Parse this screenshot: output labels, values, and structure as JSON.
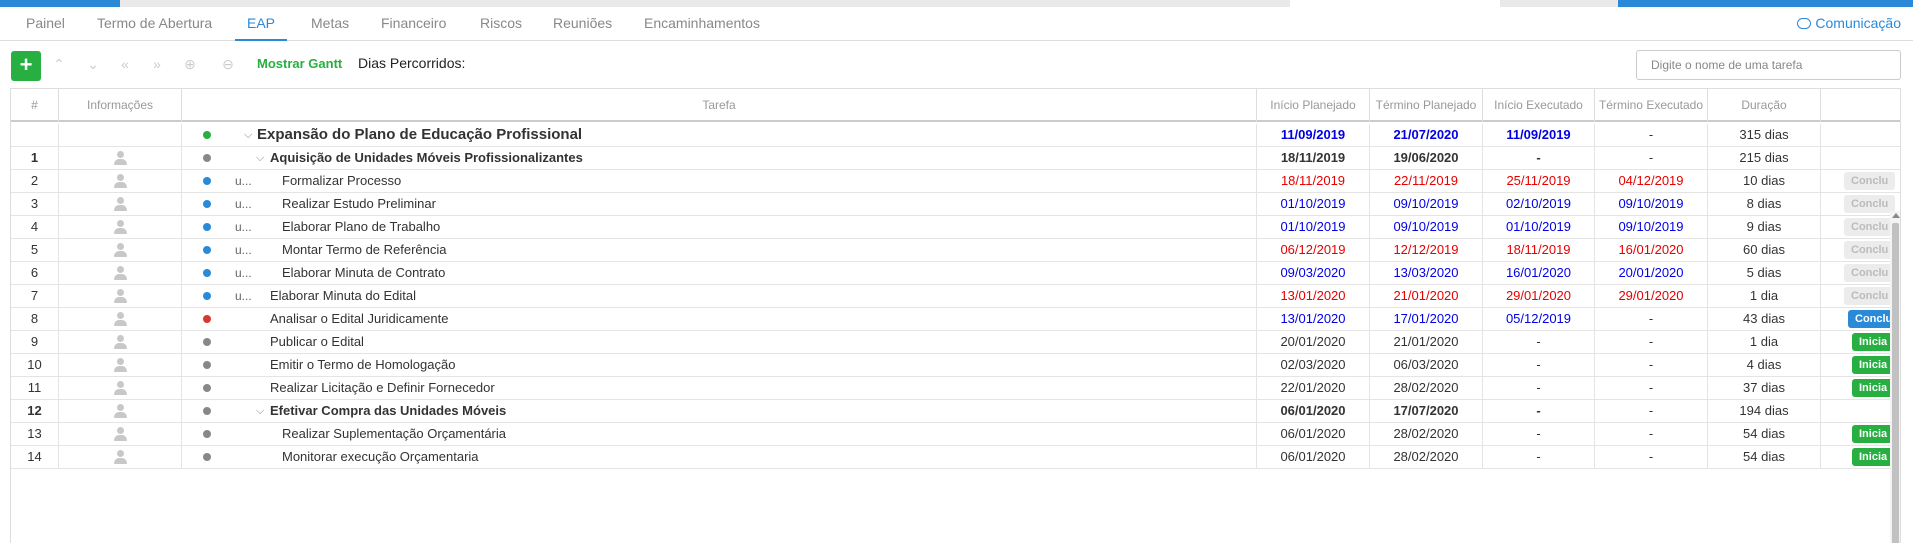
{
  "tabs": [
    {
      "label": "Painel",
      "active": false
    },
    {
      "label": "Termo de Abertura",
      "active": false
    },
    {
      "label": "EAP",
      "active": true
    },
    {
      "label": "Metas",
      "active": false
    },
    {
      "label": "Financeiro",
      "active": false
    },
    {
      "label": "Riscos",
      "active": false
    },
    {
      "label": "Reuniões",
      "active": false
    },
    {
      "label": "Encaminhamentos",
      "active": false
    }
  ],
  "communication_label": "Comunicação",
  "toolbar": {
    "add_label": "+",
    "gantt_label": "Mostrar Gantt",
    "dias_label": "Dias Percorridos:",
    "search_placeholder": "Digite o nome de uma tarefa"
  },
  "columns": [
    "#",
    "Informações",
    "Tarefa",
    "Início Planejado",
    "Término Planejado",
    "Início Executado",
    "Término Executado",
    "Duração",
    ""
  ],
  "colors": {
    "accent": "#2a8ad8",
    "green": "#27b041",
    "red_dot": "#d9382e",
    "gray_dot": "#888888",
    "late_red": "#e60000",
    "ontime_blue": "#0000e6"
  },
  "rows": [
    {
      "num": "",
      "avatar": false,
      "dot": "green",
      "user": "",
      "chevron": true,
      "indent": 0,
      "name": "Expansão do Plano de Educação Profissional",
      "ip": "11/09/2019",
      "tp": "21/07/2020",
      "ie": "11/09/2019",
      "te": "-",
      "dur": "315 dias",
      "color": "blue",
      "bold": true,
      "big": true,
      "action": ""
    },
    {
      "num": "1",
      "avatar": true,
      "dot": "gray",
      "user": "",
      "chevron": true,
      "indent": 1,
      "name": "Aquisição de Unidades Móveis Profissionalizantes",
      "ip": "18/11/2019",
      "tp": "19/06/2020",
      "ie": "-",
      "te": "-",
      "dur": "215 dias",
      "color": "",
      "bold": true,
      "big": false,
      "action": ""
    },
    {
      "num": "2",
      "avatar": true,
      "dot": "blue",
      "user": "u...",
      "chevron": false,
      "indent": 2,
      "name": "Formalizar Processo",
      "ip": "18/11/2019",
      "tp": "22/11/2019",
      "ie": "25/11/2019",
      "te": "04/12/2019",
      "dur": "10 dias",
      "color": "red",
      "bold": false,
      "big": false,
      "action": "gray"
    },
    {
      "num": "3",
      "avatar": true,
      "dot": "blue",
      "user": "u...",
      "chevron": false,
      "indent": 2,
      "name": "Realizar Estudo Preliminar",
      "ip": "01/10/2019",
      "tp": "09/10/2019",
      "ie": "02/10/2019",
      "te": "09/10/2019",
      "dur": "8 dias",
      "color": "blue",
      "bold": false,
      "big": false,
      "action": "gray"
    },
    {
      "num": "4",
      "avatar": true,
      "dot": "blue",
      "user": "u...",
      "chevron": false,
      "indent": 2,
      "name": "Elaborar Plano de Trabalho",
      "ip": "01/10/2019",
      "tp": "09/10/2019",
      "ie": "01/10/2019",
      "te": "09/10/2019",
      "dur": "9 dias",
      "color": "blue",
      "bold": false,
      "big": false,
      "action": "gray"
    },
    {
      "num": "5",
      "avatar": true,
      "dot": "blue",
      "user": "u...",
      "chevron": false,
      "indent": 2,
      "name": "Montar Termo de Referência",
      "ip": "06/12/2019",
      "tp": "12/12/2019",
      "ie": "18/11/2019",
      "te": "16/01/2020",
      "dur": "60 dias",
      "color": "red",
      "bold": false,
      "big": false,
      "action": "gray"
    },
    {
      "num": "6",
      "avatar": true,
      "dot": "blue",
      "user": "u...",
      "chevron": false,
      "indent": 2,
      "name": "Elaborar Minuta de Contrato",
      "ip": "09/03/2020",
      "tp": "13/03/2020",
      "ie": "16/01/2020",
      "te": "20/01/2020",
      "dur": "5 dias",
      "color": "blue",
      "bold": false,
      "big": false,
      "action": "gray"
    },
    {
      "num": "7",
      "avatar": true,
      "dot": "blue",
      "user": "u...",
      "chevron": false,
      "indent": 1,
      "name": "Elaborar Minuta do Edital",
      "ip": "13/01/2020",
      "tp": "21/01/2020",
      "ie": "29/01/2020",
      "te": "29/01/2020",
      "dur": "1 dia",
      "color": "red",
      "bold": false,
      "big": false,
      "action": "gray"
    },
    {
      "num": "8",
      "avatar": true,
      "dot": "red",
      "user": "",
      "chevron": false,
      "indent": 1,
      "name": "Analisar o Edital Juridicamente",
      "ip": "13/01/2020",
      "tp": "17/01/2020",
      "ie": "05/12/2019",
      "te": "-",
      "dur": "43 dias",
      "color": "blue",
      "bold": false,
      "big": false,
      "action": "blue"
    },
    {
      "num": "9",
      "avatar": true,
      "dot": "gray",
      "user": "",
      "chevron": false,
      "indent": 1,
      "name": "Publicar o Edital",
      "ip": "20/01/2020",
      "tp": "21/01/2020",
      "ie": "-",
      "te": "-",
      "dur": "1 dia",
      "color": "",
      "bold": false,
      "big": false,
      "action": "green"
    },
    {
      "num": "10",
      "avatar": true,
      "dot": "gray",
      "user": "",
      "chevron": false,
      "indent": 1,
      "name": "Emitir o Termo de Homologação",
      "ip": "02/03/2020",
      "tp": "06/03/2020",
      "ie": "-",
      "te": "-",
      "dur": "4 dias",
      "color": "",
      "bold": false,
      "big": false,
      "action": "green"
    },
    {
      "num": "11",
      "avatar": true,
      "dot": "gray",
      "user": "",
      "chevron": false,
      "indent": 1,
      "name": "Realizar Licitação e Definir Fornecedor",
      "ip": "22/01/2020",
      "tp": "28/02/2020",
      "ie": "-",
      "te": "-",
      "dur": "37 dias",
      "color": "",
      "bold": false,
      "big": false,
      "action": "green"
    },
    {
      "num": "12",
      "avatar": true,
      "dot": "gray",
      "user": "",
      "chevron": true,
      "indent": 1,
      "name": "Efetivar Compra das Unidades Móveis",
      "ip": "06/01/2020",
      "tp": "17/07/2020",
      "ie": "-",
      "te": "-",
      "dur": "194 dias",
      "color": "",
      "bold": true,
      "big": false,
      "action": ""
    },
    {
      "num": "13",
      "avatar": true,
      "dot": "gray",
      "user": "",
      "chevron": false,
      "indent": 2,
      "name": "Realizar Suplementação Orçamentária",
      "ip": "06/01/2020",
      "tp": "28/02/2020",
      "ie": "-",
      "te": "-",
      "dur": "54 dias",
      "color": "",
      "bold": false,
      "big": false,
      "action": "green"
    },
    {
      "num": "14",
      "avatar": true,
      "dot": "gray",
      "user": "",
      "chevron": false,
      "indent": 2,
      "name": "Monitorar execução Orçamentaria",
      "ip": "06/01/2020",
      "tp": "28/02/2020",
      "ie": "-",
      "te": "-",
      "dur": "54 dias",
      "color": "",
      "bold": false,
      "big": false,
      "action": "green"
    }
  ],
  "action_labels": {
    "gray": "Conclu",
    "blue": "Conclu",
    "green": "Inicia"
  }
}
